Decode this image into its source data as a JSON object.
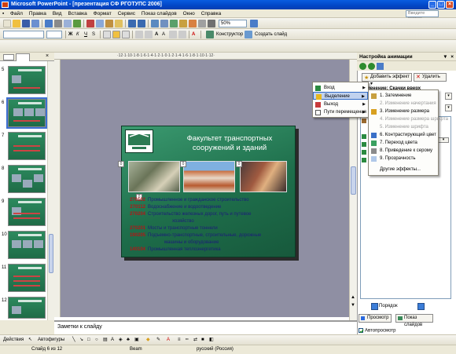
{
  "window": {
    "title": "Microsoft PowerPoint - [презентация СФ РГОТУПС 2006]"
  },
  "menubar": {
    "items": [
      "Файл",
      "Правка",
      "Вид",
      "Вставка",
      "Формат",
      "Сервис",
      "Показ слайдов",
      "Окно",
      "Справка"
    ],
    "help_placeholder": "Введите вопрос"
  },
  "toolbar": {
    "zoom": "50%",
    "designer_label": "Конструктор",
    "new_slide_label": "Создать слайд"
  },
  "thumbnails": {
    "numbers": [
      "5",
      "6",
      "7",
      "8",
      "9",
      "10",
      "11",
      "12"
    ],
    "selected": "6"
  },
  "ruler": {
    "marks": "·12·1·10·1·8·1·6·1·4·1·2·1·0·1·2·1·4·1·6·1·8·1·10·1·12·"
  },
  "slide": {
    "title": "Факультет транспортных сооружений и зданий",
    "rows": [
      {
        "code": "270102",
        "text": "Промышленное и гражданское строительство"
      },
      {
        "code": "270112",
        "text": "Водоснабжение и водоотведение"
      },
      {
        "code": "270204",
        "text": "Строительство железных дорог, путь и путевое"
      },
      {
        "code": "",
        "text": "хозяйство"
      },
      {
        "code": "270201",
        "text": "Мосты и транспортные тоннели"
      },
      {
        "code": "190205",
        "text": "Подъемно-транспортные, строительные, дорожные"
      },
      {
        "code": "",
        "text": "машины и оборудование"
      },
      {
        "code": "140104",
        "text": "Промышленная теплоэнергетика"
      }
    ],
    "markers": [
      "0",
      "0",
      "0",
      "0"
    ]
  },
  "notes": {
    "placeholder": "Заметки к слайду"
  },
  "taskpane": {
    "title": "Настройка анимации",
    "add_effect": "Добавить эффект",
    "delete": "Удалить",
    "change_label": "Изменение: Скачки вверх",
    "order_label": "Порядок",
    "preview": "Просмотр",
    "slideshow": "Показ слайдов",
    "autopreview": "Автопросмотр"
  },
  "effect_menu": {
    "items": [
      {
        "label": "Вход",
        "state": "normal"
      },
      {
        "label": "Выделение",
        "state": "highlighted"
      },
      {
        "label": "Выход",
        "state": "normal"
      },
      {
        "label": "Пути перемещения",
        "state": "normal"
      }
    ]
  },
  "emphasis_menu": {
    "items": [
      {
        "label": "1. Затемнение",
        "enabled": true
      },
      {
        "label": "2. Изменение начертания",
        "enabled": false
      },
      {
        "label": "3. Изменение размера",
        "enabled": true
      },
      {
        "label": "4. Изменение размера шрифта",
        "enabled": false
      },
      {
        "label": "5. Изменение шрифта",
        "enabled": false
      },
      {
        "label": "6. Контрастирующий цвет",
        "enabled": true
      },
      {
        "label": "7. Переход цвета",
        "enabled": true
      },
      {
        "label": "8. Приведение к серому",
        "enabled": true
      },
      {
        "label": "9. Прозрачность",
        "enabled": true
      },
      {
        "label": "Другие эффекты...",
        "enabled": true
      }
    ]
  },
  "drawbar": {
    "actions_label": "Действия",
    "autoshapes_label": "Автофигуры"
  },
  "statusbar": {
    "slide_info": "Слайд 6 из 12",
    "design": "Beam",
    "language": "русский (Россия)"
  },
  "colors": {
    "title_bar": "#0a5de0",
    "slide_bg": "#2c8a5e",
    "code_red": "#b01818",
    "text_blue": "#1c1c7a",
    "highlight": "#c1d2ee"
  },
  "icons": {
    "window": [
      "minimize-icon",
      "maximize-icon",
      "close-icon"
    ],
    "animation_effect": "star-icon"
  }
}
